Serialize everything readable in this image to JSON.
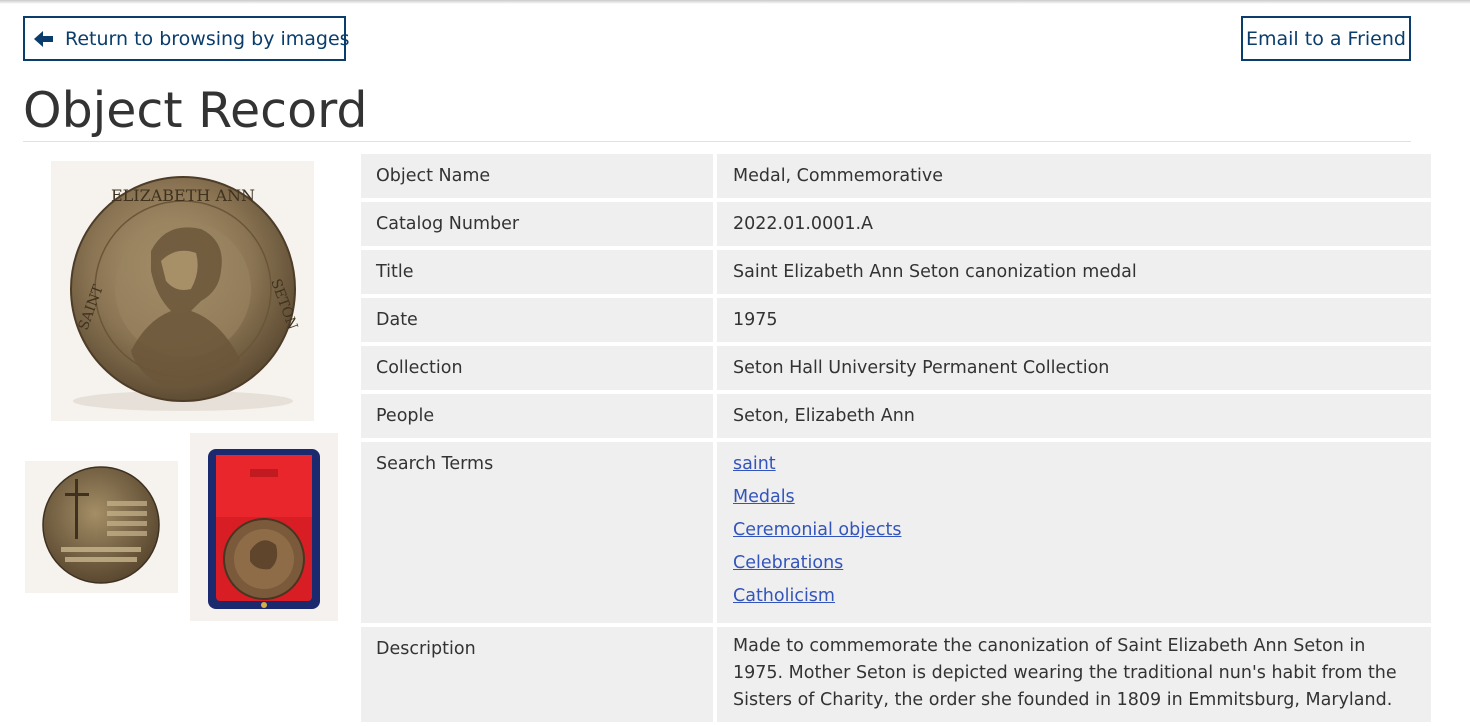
{
  "nav": {
    "back_label": "Return to browsing by images",
    "email_label": "Email to a Friend"
  },
  "page": {
    "title": "Object Record"
  },
  "images": {
    "main_icon": "medal-front-image",
    "thumb1_icon": "medal-back-image",
    "thumb2_icon": "medal-in-case-image"
  },
  "record": {
    "object_name": {
      "label": "Object Name",
      "value": "Medal, Commemorative"
    },
    "catalog_number": {
      "label": "Catalog Number",
      "value": "2022.01.0001.A"
    },
    "title": {
      "label": "Title",
      "value": "Saint Elizabeth Ann Seton canonization medal"
    },
    "date": {
      "label": "Date",
      "value": "1975"
    },
    "collection": {
      "label": "Collection",
      "value": "Seton Hall University Permanent Collection"
    },
    "people": {
      "label": "People",
      "value": "Seton, Elizabeth Ann"
    },
    "search_terms": {
      "label": "Search Terms",
      "terms": [
        "saint",
        "Medals",
        "Ceremonial objects",
        "Celebrations",
        "Catholicism"
      ]
    },
    "description": {
      "label": "Description",
      "value": "Made to commemorate the canonization of Saint Elizabeth Ann Seton in 1975. Mother Seton is depicted wearing the traditional nun's habit from the Sisters of Charity, the order she founded in 1809 in Emmitsburg, Maryland."
    }
  },
  "colors": {
    "accent": "#0a3d6b",
    "link": "#3355bb",
    "cell_background": "#efefef"
  }
}
